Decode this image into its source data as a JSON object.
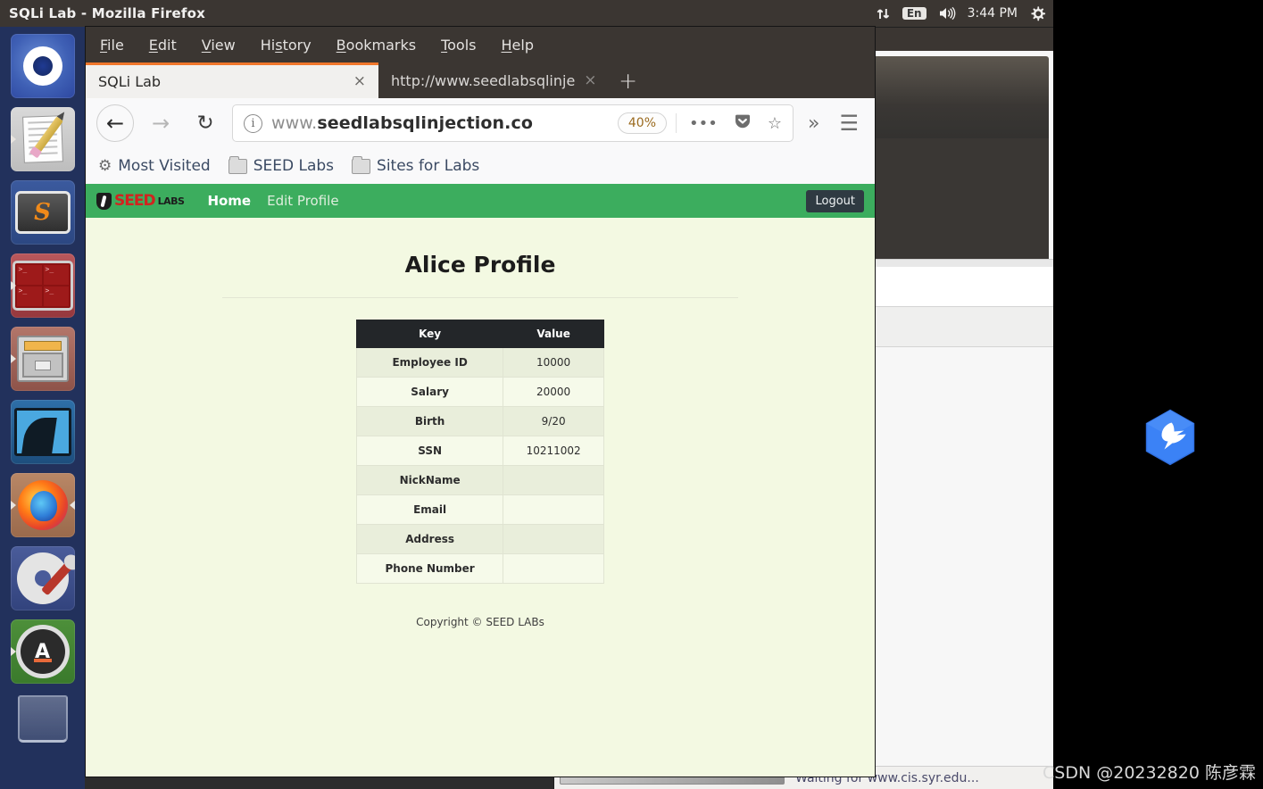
{
  "desktop": {
    "window_title": "SQLi Lab - Mozilla Firefox",
    "tray": {
      "network_icon": "network-up-down-icon",
      "keyboard_layout": "En",
      "volume_icon": "volume-icon",
      "clock": "3:44 PM",
      "settings_icon": "gear-icon"
    },
    "launcher": [
      {
        "name": "ubuntu-dash",
        "label": "Ubuntu Dash"
      },
      {
        "name": "text-editor",
        "label": "Text Editor"
      },
      {
        "name": "sublime-text",
        "label": "Sublime Text",
        "glyph": "S"
      },
      {
        "name": "terminal",
        "label": "Terminal",
        "glyph": ">_"
      },
      {
        "name": "file-manager",
        "label": "Files"
      },
      {
        "name": "wireshark",
        "label": "Wireshark"
      },
      {
        "name": "firefox",
        "label": "Firefox"
      },
      {
        "name": "system-settings",
        "label": "System Settings"
      },
      {
        "name": "software-updater",
        "label": "Software Updater",
        "glyph": "A"
      },
      {
        "name": "trash",
        "label": "Trash"
      }
    ],
    "background_window": {
      "status_text": "Waiting for www.cis.syr.edu..."
    },
    "desktop_icon": "hummingbird-hex-icon",
    "watermark": "CSDN @20232820 陈彦霖"
  },
  "browser": {
    "menus": [
      {
        "pre": "",
        "accel": "F",
        "post": "ile"
      },
      {
        "pre": "",
        "accel": "E",
        "post": "dit"
      },
      {
        "pre": "",
        "accel": "V",
        "post": "iew"
      },
      {
        "pre": "Hi",
        "accel": "s",
        "post": "tory"
      },
      {
        "pre": "",
        "accel": "B",
        "post": "ookmarks"
      },
      {
        "pre": "",
        "accel": "T",
        "post": "ools"
      },
      {
        "pre": "",
        "accel": "H",
        "post": "elp"
      }
    ],
    "tabs": [
      {
        "title": "SQLi Lab",
        "active": true,
        "close": "×"
      },
      {
        "title": "http://www.seedlabsqlinje",
        "active": false,
        "close": "×"
      }
    ],
    "new_tab_label": "+",
    "nav": {
      "back_icon": "←",
      "forward_icon": "→",
      "reload_icon": "↻",
      "info_icon": "i",
      "url_prefix": "www.",
      "url_domain": "seedlabsqlinjection.co",
      "url_full": "www.seedlabsqlinjection.com",
      "zoom_level": "40%",
      "page_actions_icon": "•••",
      "pocket_icon": "pocket-icon",
      "bookmark_star_icon": "☆",
      "overflow_icon": "»",
      "menu_icon": "☰"
    },
    "bookmarks": [
      {
        "icon": "gear-icon",
        "label": "Most Visited"
      },
      {
        "icon": "folder-icon",
        "label": "SEED Labs"
      },
      {
        "icon": "folder-icon",
        "label": "Sites for Labs"
      }
    ]
  },
  "page": {
    "navbar": {
      "brand_word": "SEED",
      "brand_suffix": "LABS",
      "links": [
        {
          "label": "Home",
          "active": true
        },
        {
          "label": "Edit Profile",
          "active": false
        }
      ],
      "logout_label": "Logout"
    },
    "title": "Alice Profile",
    "table": {
      "headers": [
        "Key",
        "Value"
      ],
      "rows": [
        {
          "key": "Employee ID",
          "value": "10000"
        },
        {
          "key": "Salary",
          "value": "20000"
        },
        {
          "key": "Birth",
          "value": "9/20"
        },
        {
          "key": "SSN",
          "value": "10211002"
        },
        {
          "key": "NickName",
          "value": ""
        },
        {
          "key": "Email",
          "value": ""
        },
        {
          "key": "Address",
          "value": ""
        },
        {
          "key": "Phone Number",
          "value": ""
        }
      ]
    },
    "copyright": "Copyright © SEED LABs"
  },
  "colors": {
    "panel": "#3b3632",
    "seed_green": "#3cad5e",
    "page_bg": "#f3f9e2",
    "table_header": "#232629",
    "firefox_orange": "#f0762b",
    "brand_red": "#d2231f"
  }
}
